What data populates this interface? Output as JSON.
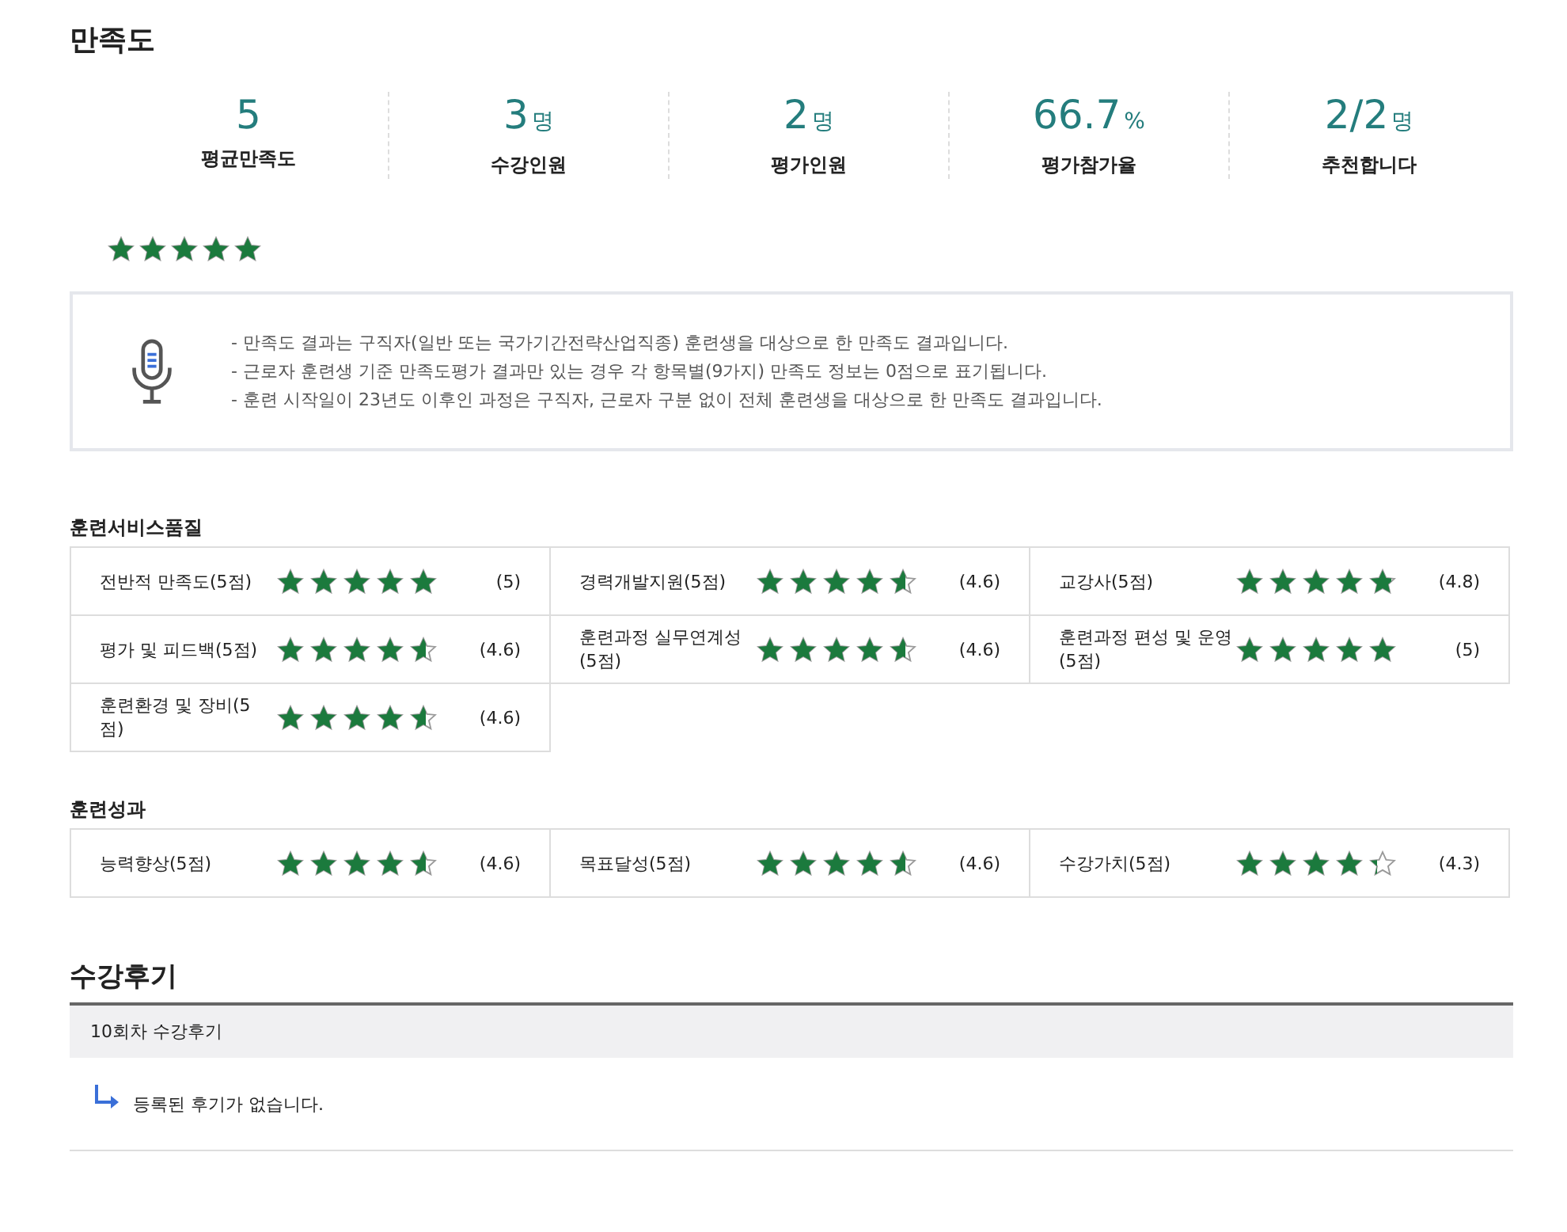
{
  "satisfaction": {
    "title": "만족도",
    "stats": [
      {
        "value": "5",
        "label": "평균만족도"
      },
      {
        "value": "3",
        "unit": "명",
        "label": "수강인원"
      },
      {
        "value": "2",
        "unit": "명",
        "label": "평가인원"
      },
      {
        "value": "66.7",
        "unit": "%",
        "label": "평가참가율"
      },
      {
        "value": "2/2",
        "unit": "명",
        "label": "추천합니다"
      }
    ],
    "stars": 5,
    "notices": [
      "- 만족도 결과는 구직자(일반 또는 국가기간전략산업직종) 훈련생을 대상으로 한 만족도 결과입니다.",
      "- 근로자 훈련생 기준 만족도평가 결과만 있는 경우 각 항목별(9가지) 만족도 정보는 0점으로 표기됩니다.",
      "- 훈련 시작일이 23년도 이후인 과정은 구직자, 근로자 구분 없이 전체 훈련생을 대상으로 한 만족도 결과입니다."
    ]
  },
  "sections": [
    {
      "title": "훈련서비스품질",
      "items": [
        {
          "label": "전반적 만족도(5점)",
          "stars": 5,
          "score": "(5)"
        },
        {
          "label": "경력개발지원(5점)",
          "stars": 4.6,
          "score": "(4.6)"
        },
        {
          "label": "교강사(5점)",
          "stars": 4.8,
          "score": "(4.8)"
        },
        {
          "label": "평가 및 피드백(5점)",
          "stars": 4.6,
          "score": "(4.6)"
        },
        {
          "label": "훈련과정 실무연계성(5점)",
          "stars": 4.6,
          "score": "(4.6)"
        },
        {
          "label": "훈련과정 편성 및 운영(5점)",
          "stars": 5,
          "score": "(5)"
        },
        {
          "label": "훈련환경 및 장비(5점)",
          "stars": 4.6,
          "score": "(4.6)"
        }
      ]
    },
    {
      "title": "훈련성과",
      "items": [
        {
          "label": "능력향상(5점)",
          "stars": 4.6,
          "score": "(4.6)"
        },
        {
          "label": "목표달성(5점)",
          "stars": 4.6,
          "score": "(4.6)"
        },
        {
          "label": "수강가치(5점)",
          "stars": 4.3,
          "score": "(4.3)"
        }
      ]
    }
  ],
  "reviews": {
    "title": "수강후기",
    "header": "10회차 수강후기",
    "empty": "등록된 후기가 없습니다."
  }
}
